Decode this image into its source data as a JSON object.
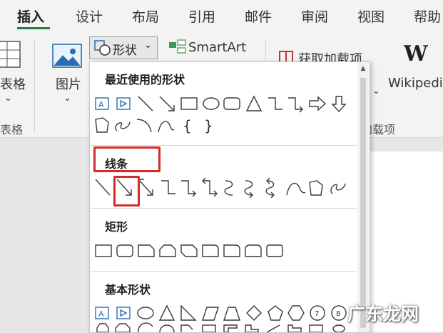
{
  "tabs": [
    "插入",
    "设计",
    "布局",
    "引用",
    "邮件",
    "审阅",
    "视图",
    "帮助"
  ],
  "active_tab": "插入",
  "ribbon": {
    "table_label": "表格",
    "table_group_label": "表格",
    "picture_label": "图片",
    "shapes_button_label": "形状",
    "smartart_label": "SmartArt",
    "addins_label": "获取加载项",
    "addins_group_label": "加载项",
    "wikipedia_label": "Wikipedi"
  },
  "dropdown": {
    "sections": [
      {
        "title": "最近使用的形状"
      },
      {
        "title": "线条"
      },
      {
        "title": "矩形"
      },
      {
        "title": "基本形状"
      }
    ]
  },
  "colors": {
    "accent": "#2b7a4b",
    "highlight": "#d42b2b",
    "shape_blue": "#2b6cb0"
  },
  "watermark": "广东龙网"
}
